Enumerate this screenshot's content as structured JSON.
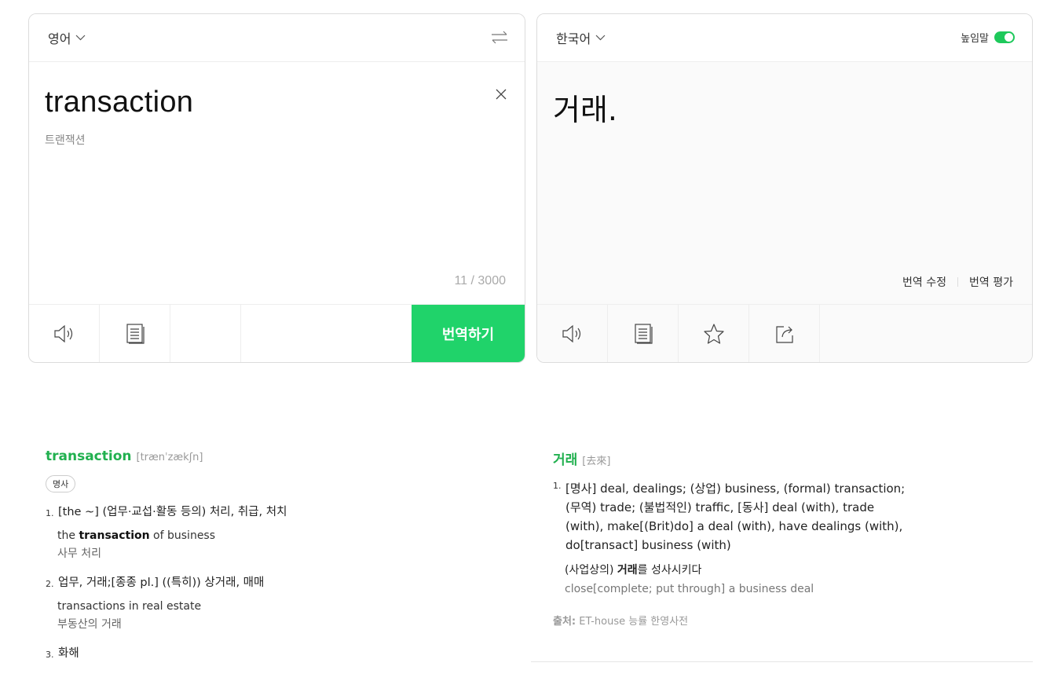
{
  "source": {
    "language": "영어",
    "text": "transaction",
    "pronunciation": "트랜잭션",
    "char_count": "11 / 3000",
    "translate_button": "번역하기"
  },
  "target": {
    "language": "한국어",
    "honorific_label": "높임말",
    "honorific_on": true,
    "text": "거래.",
    "edit_label": "번역 수정",
    "rate_label": "번역 평가"
  },
  "dictionary": {
    "english": {
      "word": "transaction",
      "phonetic": "[trænˈzækʃn]",
      "pos": "명사",
      "senses": [
        {
          "num": "1.",
          "text": "[the ~] (업무·교섭·활동 등의) 처리, 취급, 처치",
          "ex_pre": "the ",
          "ex_bold": "transaction",
          "ex_post": " of business",
          "ex_ko": "사무 처리"
        },
        {
          "num": "2.",
          "text": "업무, 거래;[종종 pl.] ((특히)) 상거래, 매매",
          "ex_pre": "transactions in real estate",
          "ex_bold": "",
          "ex_post": "",
          "ex_ko": "부동산의 거래"
        },
        {
          "num": "3.",
          "text": "화해"
        }
      ]
    },
    "korean": {
      "word": "거래",
      "hanja": "[去來]",
      "sense_num": "1.",
      "sense_text": "[명사] deal, dealings; (상업) business, (formal) transaction; (무역) trade; (불법적인) traffic, [동사] deal (with), trade (with), make[(Brit)do] a deal (with), have dealings (with), do[transact] business (with)",
      "ex_pre": "(사업상의) ",
      "ex_bold": "거래",
      "ex_post": "를 성사시키다",
      "ex_en": "close[complete; put through] a business deal",
      "source_label": "출처:",
      "source_value": " ET-house 능률 한영사전"
    }
  },
  "colors": {
    "accent": "#20d36a",
    "headword": "#21b04f"
  }
}
